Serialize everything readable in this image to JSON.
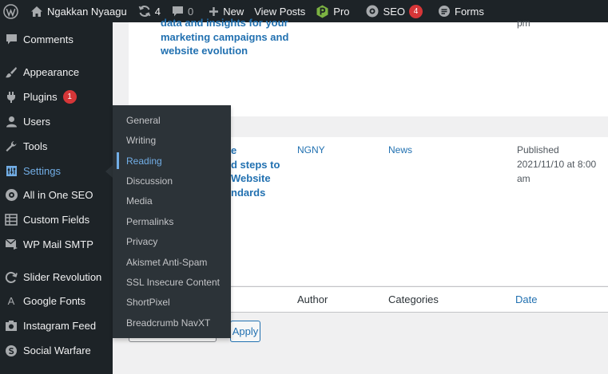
{
  "adminbar": {
    "site_name": "Ngakkan Nyaagu",
    "updates_count": "4",
    "comments_count": "0",
    "new_label": "New",
    "view_posts_label": "View Posts",
    "pro_label": "Pro",
    "seo_label": "SEO",
    "seo_count": "4",
    "forms_label": "Forms"
  },
  "sidebar": {
    "items": [
      {
        "label": "Comments",
        "icon": "comment-icon"
      },
      {
        "label": "Appearance",
        "icon": "paintbrush-icon"
      },
      {
        "label": "Plugins",
        "icon": "plug-icon",
        "badge": "1"
      },
      {
        "label": "Users",
        "icon": "user-icon"
      },
      {
        "label": "Tools",
        "icon": "wrench-icon"
      },
      {
        "label": "Settings",
        "icon": "settings-icon",
        "current": true
      },
      {
        "label": "All in One SEO",
        "icon": "gear-icon"
      },
      {
        "label": "Custom Fields",
        "icon": "table-icon"
      },
      {
        "label": "WP Mail SMTP",
        "icon": "mail-icon"
      },
      {
        "label": "Slider Revolution",
        "icon": "refresh-icon"
      },
      {
        "label": "Google Fonts",
        "icon": "font-icon"
      },
      {
        "label": "Instagram Feed",
        "icon": "camera-icon"
      },
      {
        "label": "Social Warfare",
        "icon": "social-icon"
      }
    ]
  },
  "settings_submenu": {
    "items": [
      "General",
      "Writing",
      "Reading",
      "Discussion",
      "Media",
      "Permalinks",
      "Privacy",
      "Akismet Anti-Spam",
      "SSL Insecure Content",
      "ShortPixel",
      "Breadcrumb NavXT"
    ],
    "current": "Reading"
  },
  "posts": {
    "row1_title_lines": [
      "data and insights for your",
      "marketing campaigns and",
      "website evolution"
    ],
    "row1_date_fragment": "pm",
    "row2_title_lines": [
      "e",
      "d steps to",
      "Website",
      "ndards"
    ],
    "row2_author": "NGNY",
    "row2_category": "News",
    "row2_status": "Published",
    "row2_date_line1": "2021/11/10 at 8:00",
    "row2_date_line2": "am"
  },
  "table_footer": {
    "author": "Author",
    "categories": "Categories",
    "date": "Date"
  },
  "bulk": {
    "apply_label": "Apply"
  },
  "colors": {
    "adminbar_bg": "#1d2327",
    "link": "#2271b1",
    "current": "#72aee6",
    "badge": "#d63638"
  }
}
